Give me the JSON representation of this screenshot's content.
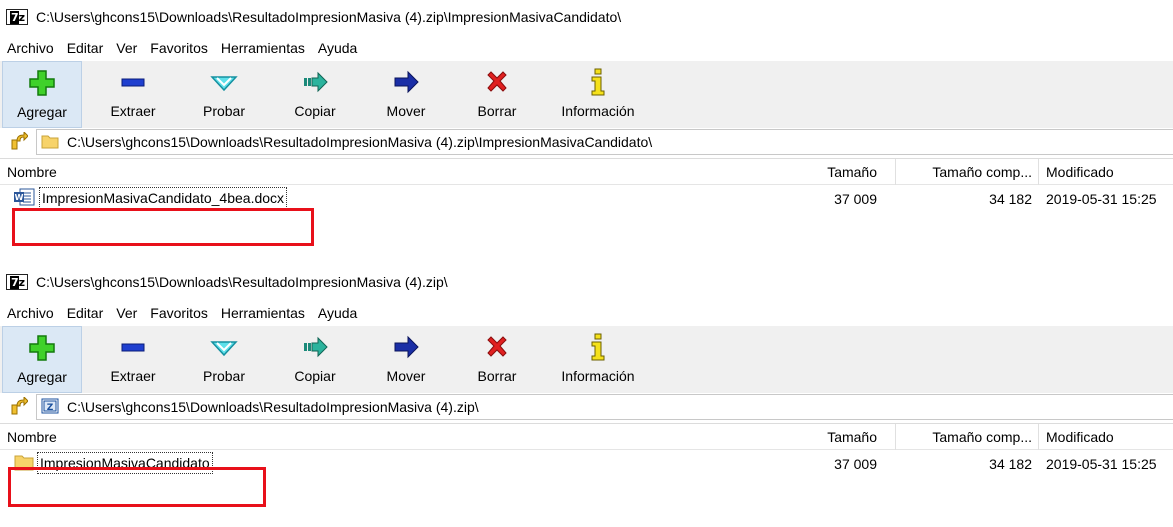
{
  "windows": [
    {
      "title": "C:\\Users\\ghcons15\\Downloads\\ResultadoImpresionMasiva (4).zip\\ImpresionMasivaCandidato\\",
      "menu": [
        "Archivo",
        "Editar",
        "Ver",
        "Favoritos",
        "Herramientas",
        "Ayuda"
      ],
      "toolbar": [
        "Agregar",
        "Extraer",
        "Probar",
        "Copiar",
        "Mover",
        "Borrar",
        "Información"
      ],
      "address": "C:\\Users\\ghcons15\\Downloads\\ResultadoImpresionMasiva (4).zip\\ImpresionMasivaCandidato\\",
      "address_icon": "folder-icon",
      "columns": {
        "name": "Nombre",
        "size": "Tamaño",
        "packed": "Tamaño comp...",
        "modified": "Modificado"
      },
      "rows": [
        {
          "icon": "docx-file-icon",
          "name": "ImpresionMasivaCandidato_4bea.docx",
          "size": "37 009",
          "packed": "34 182",
          "modified": "2019-05-31 15:25"
        }
      ]
    },
    {
      "title": "C:\\Users\\ghcons15\\Downloads\\ResultadoImpresionMasiva (4).zip\\",
      "menu": [
        "Archivo",
        "Editar",
        "Ver",
        "Favoritos",
        "Herramientas",
        "Ayuda"
      ],
      "toolbar": [
        "Agregar",
        "Extraer",
        "Probar",
        "Copiar",
        "Mover",
        "Borrar",
        "Información"
      ],
      "address": "C:\\Users\\ghcons15\\Downloads\\ResultadoImpresionMasiva (4).zip\\",
      "address_icon": "zip-archive-icon",
      "columns": {
        "name": "Nombre",
        "size": "Tamaño",
        "packed": "Tamaño comp...",
        "modified": "Modificado"
      },
      "rows": [
        {
          "icon": "folder-icon",
          "name": "ImpresionMasivaCandidato",
          "size": "37 009",
          "packed": "34 182",
          "modified": "2019-05-31 15:25"
        }
      ]
    }
  ],
  "colors": {
    "highlight_box": "#e8101a",
    "toolbar_bg": "#f0f0f0",
    "active_button": "#dbe8f5"
  }
}
